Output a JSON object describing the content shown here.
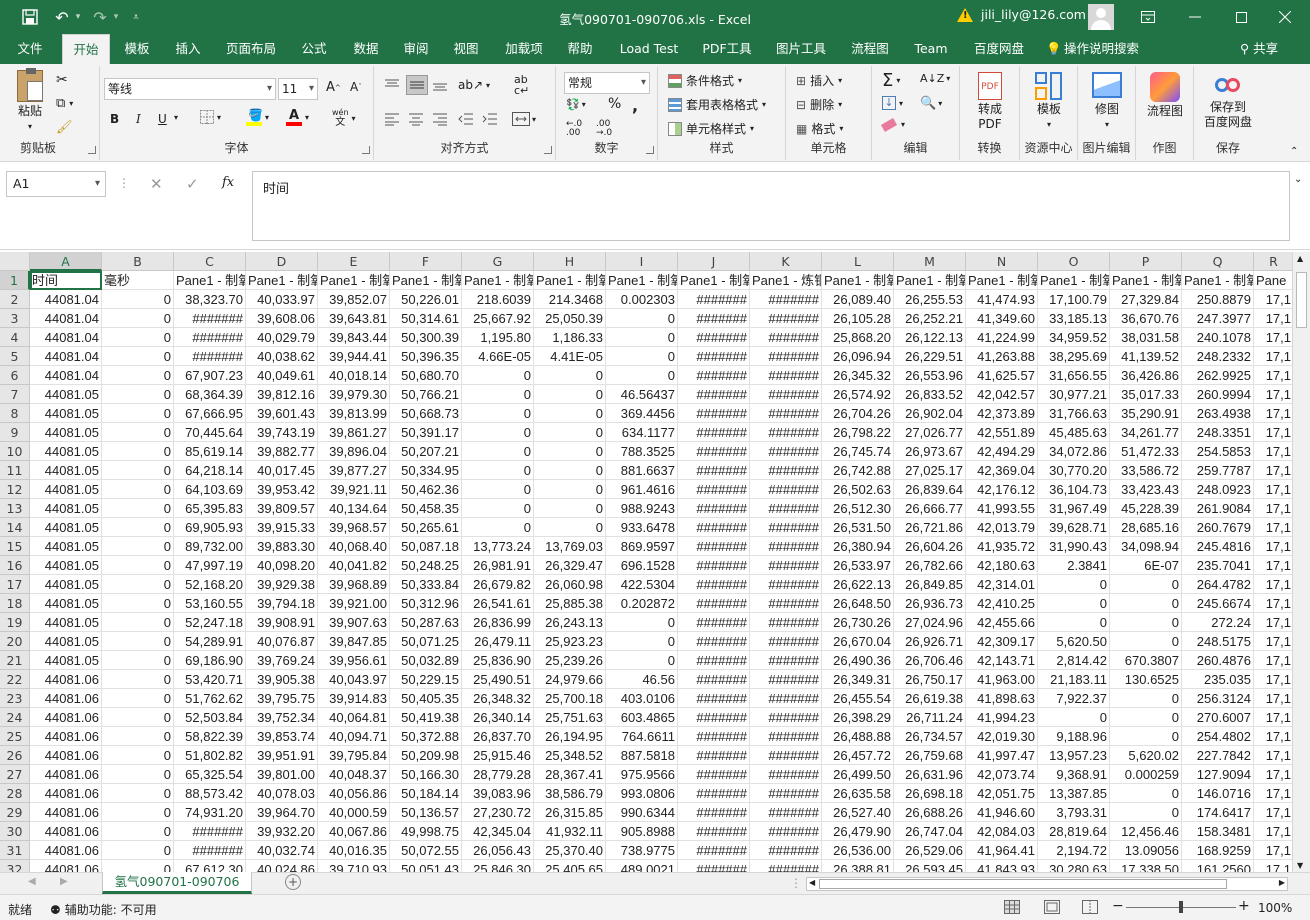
{
  "titlebar": {
    "title": "氢气090701-090706.xls  -  Excel",
    "account": "jili_lily@126.com",
    "qat": [
      "save-icon",
      "undo-icon",
      "redo-icon",
      "customize-icon"
    ],
    "window_controls": [
      "ribbon-display-icon",
      "minimize-icon",
      "maximize-icon",
      "close-icon"
    ]
  },
  "menu": {
    "tabs": [
      "文件",
      "开始",
      "模板",
      "插入",
      "页面布局",
      "公式",
      "数据",
      "审阅",
      "视图",
      "加载项",
      "帮助",
      "Load Test",
      "PDF工具",
      "图片工具",
      "流程图",
      "Team",
      "百度网盘"
    ],
    "active": "开始",
    "search": "操作说明搜索",
    "share": "共享"
  },
  "ribbon": {
    "clipboard": {
      "label": "剪贴板",
      "paste": "粘贴"
    },
    "font": {
      "label": "字体",
      "name": "等线",
      "size": "11",
      "bold": "B",
      "italic": "I",
      "underline": "U"
    },
    "alignment": {
      "label": "对齐方式"
    },
    "number": {
      "label": "数字",
      "format": "常规"
    },
    "styles": {
      "label": "样式",
      "conditional": "条件格式",
      "table": "套用表格格式",
      "cell": "单元格样式"
    },
    "cells": {
      "label": "单元格",
      "insert": "插入",
      "delete": "删除",
      "format": "格式"
    },
    "editing": {
      "label": "编辑"
    },
    "convert": {
      "label": "转换",
      "button": "转成\nPDF"
    },
    "templates": {
      "label": "资源中心",
      "button": "模板"
    },
    "image": {
      "label": "图片编辑",
      "button": "修图"
    },
    "drawing": {
      "label": "作图",
      "button": "流程图"
    },
    "save": {
      "label": "保存",
      "button": "保存到\n百度网盘"
    }
  },
  "formula": {
    "cell_ref": "A1",
    "content": "时间"
  },
  "grid": {
    "columns": [
      "A",
      "B",
      "C",
      "D",
      "E",
      "F",
      "G",
      "H",
      "I",
      "J",
      "K",
      "L",
      "M",
      "N",
      "O",
      "P",
      "Q",
      "R"
    ],
    "header_row": [
      "时间",
      "毫秒",
      "Pane1 - 制氧",
      "Pane1 - 制氧",
      "Pane1 - 制氧",
      "Pane1 - 制氧",
      "Pane1 - 制氧",
      "Pane1 - 制氧",
      "Pane1 - 制氧",
      "Pane1 - 制氧",
      "Pane1 - 炼钢",
      "Pane1 - 制氧",
      "Pane1 - 制氧",
      "Pane1 - 制氧",
      "Pane1 - 制氧",
      "Pane1 - 制氧",
      "Pane1 - 制氧",
      "Pane"
    ],
    "rows": [
      [
        2,
        "44081.04",
        "0",
        "38,323.70",
        "40,033.97",
        "39,852.07",
        "50,226.01",
        "218.6039",
        "214.3468",
        "0.002303",
        "#######",
        "#######",
        "26,089.40",
        "26,255.53",
        "41,474.93",
        "17,100.79",
        "27,329.84",
        "250.8879",
        "17,1"
      ],
      [
        3,
        "44081.04",
        "0",
        "#######",
        "39,608.06",
        "39,643.81",
        "50,314.61",
        "25,667.92",
        "25,050.39",
        "0",
        "#######",
        "#######",
        "26,105.28",
        "26,252.21",
        "41,349.60",
        "33,185.13",
        "36,670.76",
        "247.3977",
        "17,1"
      ],
      [
        4,
        "44081.04",
        "0",
        "#######",
        "40,029.79",
        "39,843.44",
        "50,300.39",
        "1,195.80",
        "1,186.33",
        "0",
        "#######",
        "#######",
        "25,868.20",
        "26,122.13",
        "41,224.99",
        "34,959.52",
        "38,031.58",
        "240.1078",
        "17,1"
      ],
      [
        5,
        "44081.04",
        "0",
        "#######",
        "40,038.62",
        "39,944.41",
        "50,396.35",
        "4.66E-05",
        "4.41E-05",
        "0",
        "#######",
        "#######",
        "26,096.94",
        "26,229.51",
        "41,263.88",
        "38,295.69",
        "41,139.52",
        "248.2332",
        "17,1"
      ],
      [
        6,
        "44081.04",
        "0",
        "67,907.23",
        "40,049.61",
        "40,018.14",
        "50,680.70",
        "0",
        "0",
        "0",
        "#######",
        "#######",
        "26,345.32",
        "26,553.96",
        "41,625.57",
        "31,656.55",
        "36,426.86",
        "262.9925",
        "17,1"
      ],
      [
        7,
        "44081.05",
        "0",
        "68,364.39",
        "39,812.16",
        "39,979.30",
        "50,766.21",
        "0",
        "0",
        "46.56437",
        "#######",
        "#######",
        "26,574.92",
        "26,833.52",
        "42,042.57",
        "30,977.21",
        "35,017.33",
        "260.9994",
        "17,1"
      ],
      [
        8,
        "44081.05",
        "0",
        "67,666.95",
        "39,601.43",
        "39,813.99",
        "50,668.73",
        "0",
        "0",
        "369.4456",
        "#######",
        "#######",
        "26,704.26",
        "26,902.04",
        "42,373.89",
        "31,766.63",
        "35,290.91",
        "263.4938",
        "17,1"
      ],
      [
        9,
        "44081.05",
        "0",
        "70,445.64",
        "39,743.19",
        "39,861.27",
        "50,391.17",
        "0",
        "0",
        "634.1177",
        "#######",
        "#######",
        "26,798.22",
        "27,026.77",
        "42,551.89",
        "45,485.63",
        "34,261.77",
        "248.3351",
        "17,1"
      ],
      [
        10,
        "44081.05",
        "0",
        "85,619.14",
        "39,882.77",
        "39,896.04",
        "50,207.21",
        "0",
        "0",
        "788.3525",
        "#######",
        "#######",
        "26,745.74",
        "26,973.67",
        "42,494.29",
        "34,072.86",
        "51,472.33",
        "254.5853",
        "17,1"
      ],
      [
        11,
        "44081.05",
        "0",
        "64,218.14",
        "40,017.45",
        "39,877.27",
        "50,334.95",
        "0",
        "0",
        "881.6637",
        "#######",
        "#######",
        "26,742.88",
        "27,025.17",
        "42,369.04",
        "30,770.20",
        "33,586.72",
        "259.7787",
        "17,1"
      ],
      [
        12,
        "44081.05",
        "0",
        "64,103.69",
        "39,953.42",
        "39,921.11",
        "50,462.36",
        "0",
        "0",
        "961.4616",
        "#######",
        "#######",
        "26,502.63",
        "26,839.64",
        "42,176.12",
        "36,104.73",
        "33,423.43",
        "248.0923",
        "17,1"
      ],
      [
        13,
        "44081.05",
        "0",
        "65,395.83",
        "39,809.57",
        "40,134.64",
        "50,458.35",
        "0",
        "0",
        "988.9243",
        "#######",
        "#######",
        "26,512.30",
        "26,666.77",
        "41,993.55",
        "31,967.49",
        "45,228.39",
        "261.9084",
        "17,1"
      ],
      [
        14,
        "44081.05",
        "0",
        "69,905.93",
        "39,915.33",
        "39,968.57",
        "50,265.61",
        "0",
        "0",
        "933.6478",
        "#######",
        "#######",
        "26,531.50",
        "26,721.86",
        "42,013.79",
        "39,628.71",
        "28,685.16",
        "260.7679",
        "17,1"
      ],
      [
        15,
        "44081.05",
        "0",
        "89,732.00",
        "39,883.30",
        "40,068.40",
        "50,087.18",
        "13,773.24",
        "13,769.03",
        "869.9597",
        "#######",
        "#######",
        "26,380.94",
        "26,604.26",
        "41,935.72",
        "31,990.43",
        "34,098.94",
        "245.4816",
        "17,1"
      ],
      [
        16,
        "44081.05",
        "0",
        "47,997.19",
        "40,098.20",
        "40,041.82",
        "50,248.25",
        "26,981.91",
        "26,329.47",
        "696.1528",
        "#######",
        "#######",
        "26,533.97",
        "26,782.66",
        "42,180.63",
        "2.3841",
        "6E-07",
        "235.7041",
        "17,1"
      ],
      [
        17,
        "44081.05",
        "0",
        "52,168.20",
        "39,929.38",
        "39,968.89",
        "50,333.84",
        "26,679.82",
        "26,060.98",
        "422.5304",
        "#######",
        "#######",
        "26,622.13",
        "26,849.85",
        "42,314.01",
        "0",
        "0",
        "264.4782",
        "17,1"
      ],
      [
        18,
        "44081.05",
        "0",
        "53,160.55",
        "39,794.18",
        "39,921.00",
        "50,312.96",
        "26,541.61",
        "25,885.38",
        "0.202872",
        "#######",
        "#######",
        "26,648.50",
        "26,936.73",
        "42,410.25",
        "0",
        "0",
        "245.6674",
        "17,1"
      ],
      [
        19,
        "44081.05",
        "0",
        "52,247.18",
        "39,908.91",
        "39,907.63",
        "50,287.63",
        "26,836.99",
        "26,243.13",
        "0",
        "#######",
        "#######",
        "26,730.26",
        "27,024.96",
        "42,455.66",
        "0",
        "0",
        "272.24",
        "17,1"
      ],
      [
        20,
        "44081.05",
        "0",
        "54,289.91",
        "40,076.87",
        "39,847.85",
        "50,071.25",
        "26,479.11",
        "25,923.23",
        "0",
        "#######",
        "#######",
        "26,670.04",
        "26,926.71",
        "42,309.17",
        "5,620.50",
        "0",
        "248.5175",
        "17,1"
      ],
      [
        21,
        "44081.05",
        "0",
        "69,186.90",
        "39,769.24",
        "39,956.61",
        "50,032.89",
        "25,836.90",
        "25,239.26",
        "0",
        "#######",
        "#######",
        "26,490.36",
        "26,706.46",
        "42,143.71",
        "2,814.42",
        "670.3807",
        "260.4876",
        "17,1"
      ],
      [
        22,
        "44081.06",
        "0",
        "53,420.71",
        "39,905.38",
        "40,043.97",
        "50,229.15",
        "25,490.51",
        "24,979.66",
        "46.56",
        "#######",
        "#######",
        "26,349.31",
        "26,750.17",
        "41,963.00",
        "21,183.11",
        "130.6525",
        "235.035",
        "17,1"
      ],
      [
        23,
        "44081.06",
        "0",
        "51,762.62",
        "39,795.75",
        "39,914.83",
        "50,405.35",
        "26,348.32",
        "25,700.18",
        "403.0106",
        "#######",
        "#######",
        "26,455.54",
        "26,619.38",
        "41,898.63",
        "7,922.37",
        "0",
        "256.3124",
        "17,1"
      ],
      [
        24,
        "44081.06",
        "0",
        "52,503.84",
        "39,752.34",
        "40,064.81",
        "50,419.38",
        "26,340.14",
        "25,751.63",
        "603.4865",
        "#######",
        "#######",
        "26,398.29",
        "26,711.24",
        "41,994.23",
        "0",
        "0",
        "270.6007",
        "17,1"
      ],
      [
        25,
        "44081.06",
        "0",
        "58,822.39",
        "39,853.74",
        "40,094.71",
        "50,372.88",
        "26,837.70",
        "26,194.95",
        "764.6611",
        "#######",
        "#######",
        "26,488.88",
        "26,734.57",
        "42,019.30",
        "9,188.96",
        "0",
        "254.4802",
        "17,1"
      ],
      [
        26,
        "44081.06",
        "0",
        "51,802.82",
        "39,951.91",
        "39,795.84",
        "50,209.98",
        "25,915.46",
        "25,348.52",
        "887.5818",
        "#######",
        "#######",
        "26,457.72",
        "26,759.68",
        "41,997.47",
        "13,957.23",
        "5,620.02",
        "227.7842",
        "17,1"
      ],
      [
        27,
        "44081.06",
        "0",
        "65,325.54",
        "39,801.00",
        "40,048.37",
        "50,166.30",
        "28,779.28",
        "28,367.41",
        "975.9566",
        "#######",
        "#######",
        "26,499.50",
        "26,631.96",
        "42,073.74",
        "9,368.91",
        "0.000259",
        "127.9094",
        "17,1"
      ],
      [
        28,
        "44081.06",
        "0",
        "88,573.42",
        "40,078.03",
        "40,056.86",
        "50,184.14",
        "39,083.96",
        "38,586.79",
        "993.0806",
        "#######",
        "#######",
        "26,635.58",
        "26,698.18",
        "42,051.75",
        "13,387.85",
        "0",
        "146.0716",
        "17,1"
      ],
      [
        29,
        "44081.06",
        "0",
        "74,931.20",
        "39,964.70",
        "40,000.59",
        "50,136.57",
        "27,230.72",
        "26,315.85",
        "990.6344",
        "#######",
        "#######",
        "26,527.40",
        "26,688.26",
        "41,946.60",
        "3,793.31",
        "0",
        "174.6417",
        "17,1"
      ],
      [
        30,
        "44081.06",
        "0",
        "#######",
        "39,932.20",
        "40,067.86",
        "49,998.75",
        "42,345.04",
        "41,932.11",
        "905.8988",
        "#######",
        "#######",
        "26,479.90",
        "26,747.04",
        "42,084.03",
        "28,819.64",
        "12,456.46",
        "158.3481",
        "17,1"
      ],
      [
        31,
        "44081.06",
        "0",
        "#######",
        "40,032.74",
        "40,016.35",
        "50,072.55",
        "26,056.43",
        "25,370.40",
        "738.9775",
        "#######",
        "#######",
        "26,536.00",
        "26,529.06",
        "41,964.41",
        "2,194.72",
        "13.09056",
        "168.9259",
        "17,1"
      ],
      [
        32,
        "44081.06",
        "0",
        "67,612.30",
        "40,024.86",
        "39,710.93",
        "50,051.43",
        "25,846.30",
        "25,405.65",
        "489.0021",
        "#######",
        "#######",
        "26,388.81",
        "26,593.45",
        "41,843.93",
        "30,280.63",
        "17,338.50",
        "161.2560",
        "17,1"
      ]
    ]
  },
  "sheet": {
    "name": "氢气090701-090706"
  },
  "status": {
    "ready": "就绪",
    "accessibility": "辅助功能: 不可用",
    "zoom": "100%"
  }
}
